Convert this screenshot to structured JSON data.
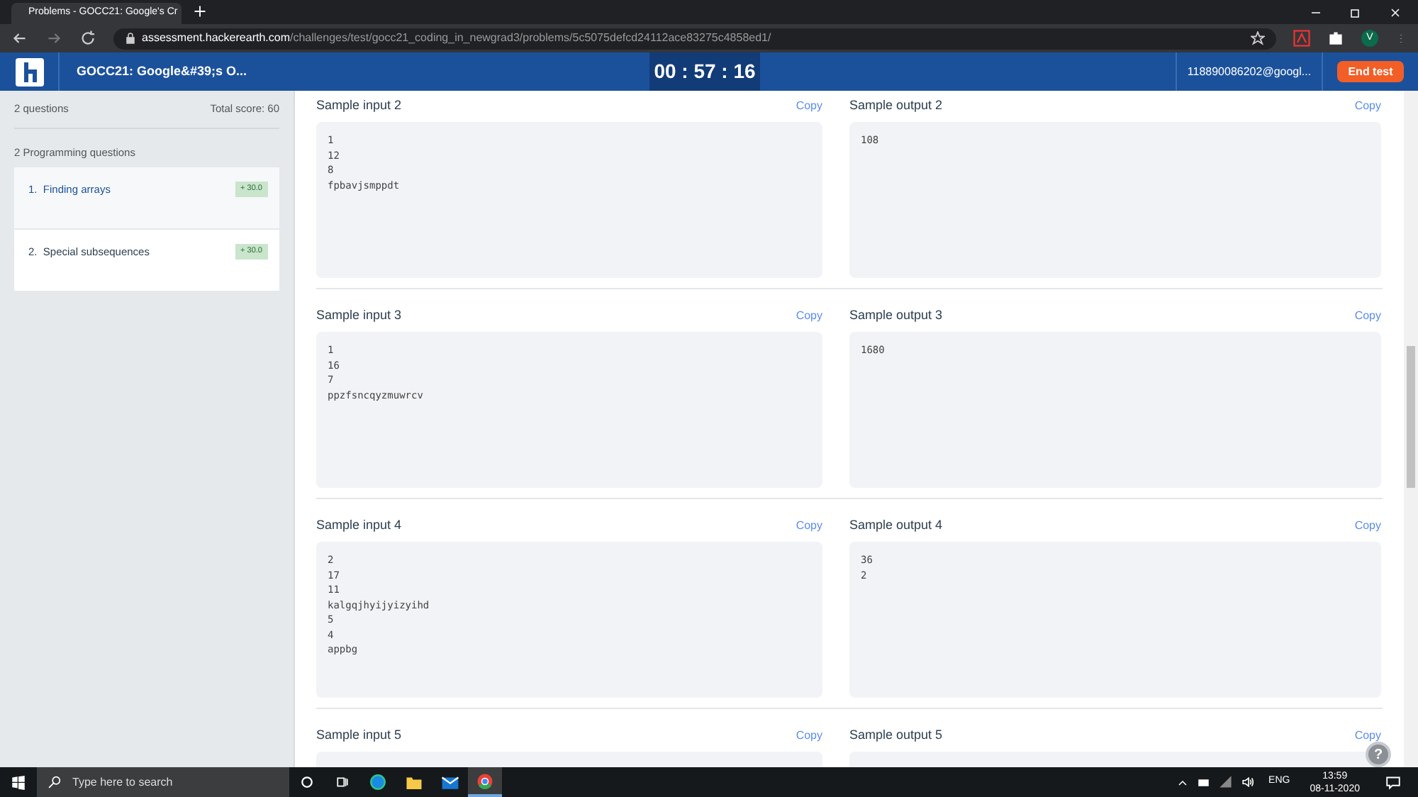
{
  "browser": {
    "tab_title": "Problems - GOCC21: Google's Cr",
    "url_host": "assessment.hackerearth.com",
    "url_path": "/challenges/test/gocc21_coding_in_newgrad3/problems/5c5075defcd24112ace83275c4858ed1/",
    "profile": "V"
  },
  "header": {
    "title": "GOCC21: Google&#39;s O...",
    "timer": "00 : 57 : 16",
    "user": "118890086202@googl...",
    "end_button": "End test"
  },
  "sidebar": {
    "count": "2 questions",
    "total": "Total score: 60",
    "section": "2 Programming questions",
    "questions": [
      {
        "label": "1.  Finding arrays",
        "score": "+ 30.0",
        "selected": true
      },
      {
        "label": "2.  Special subsequences",
        "score": "+ 30.0",
        "selected": false
      }
    ]
  },
  "samples": [
    {
      "input_title": "Sample input 2",
      "input_copy": "Copy",
      "input_lines": [
        "1",
        "12",
        "8",
        "fpbavjsmppdt"
      ],
      "output_title": "Sample output 2",
      "output_copy": "Copy",
      "output_lines": [
        "108"
      ]
    },
    {
      "input_title": "Sample input 3",
      "input_copy": "Copy",
      "input_lines": [
        "1",
        "16",
        "7",
        "ppzfsncqyzmuwrcv"
      ],
      "output_title": "Sample output 3",
      "output_copy": "Copy",
      "output_lines": [
        "1680"
      ]
    },
    {
      "input_title": "Sample input 4",
      "input_copy": "Copy",
      "input_lines": [
        "2",
        "17",
        "11",
        "kalgqjhyijyizyihd",
        "5",
        "4",
        "appbg"
      ],
      "output_title": "Sample output 4",
      "output_copy": "Copy",
      "output_lines": [
        "36",
        "2"
      ]
    },
    {
      "input_title": "Sample input 5",
      "input_copy": "Copy",
      "output_title": "Sample output 5",
      "output_copy": "Copy"
    }
  ],
  "help_button": "?",
  "taskbar": {
    "search_placeholder": "Type here to search",
    "language": "ENG",
    "time": "13:59",
    "date": "08-11-2020"
  }
}
